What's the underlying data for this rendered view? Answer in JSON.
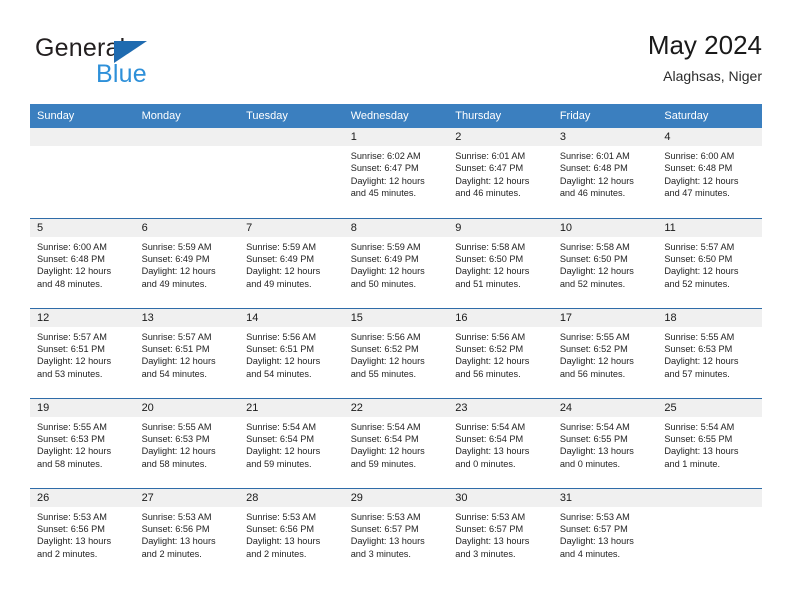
{
  "brand": {
    "name_part1": "General",
    "name_part2": "Blue",
    "triangle_color": "#1f6bb0",
    "blue_text_color": "#2e90d9"
  },
  "header": {
    "title": "May 2024",
    "subtitle": "Alaghsas, Niger"
  },
  "theme": {
    "header_row_bg": "#3b7fbf",
    "header_row_text": "#ffffff",
    "daynum_band_bg": "#f0f0f0",
    "row_separator": "#2f6ca8",
    "cell_bg": "#ffffff",
    "body_text": "#232323"
  },
  "weekday_headers": [
    "Sunday",
    "Monday",
    "Tuesday",
    "Wednesday",
    "Thursday",
    "Friday",
    "Saturday"
  ],
  "weeks": [
    [
      {
        "day": "",
        "empty": true,
        "sunrise": "",
        "sunset": "",
        "daylight_line1": "",
        "daylight_line2": ""
      },
      {
        "day": "",
        "empty": true,
        "sunrise": "",
        "sunset": "",
        "daylight_line1": "",
        "daylight_line2": ""
      },
      {
        "day": "",
        "empty": true,
        "sunrise": "",
        "sunset": "",
        "daylight_line1": "",
        "daylight_line2": ""
      },
      {
        "day": "1",
        "sunrise": "Sunrise: 6:02 AM",
        "sunset": "Sunset: 6:47 PM",
        "daylight_line1": "Daylight: 12 hours",
        "daylight_line2": "and 45 minutes."
      },
      {
        "day": "2",
        "sunrise": "Sunrise: 6:01 AM",
        "sunset": "Sunset: 6:47 PM",
        "daylight_line1": "Daylight: 12 hours",
        "daylight_line2": "and 46 minutes."
      },
      {
        "day": "3",
        "sunrise": "Sunrise: 6:01 AM",
        "sunset": "Sunset: 6:48 PM",
        "daylight_line1": "Daylight: 12 hours",
        "daylight_line2": "and 46 minutes."
      },
      {
        "day": "4",
        "sunrise": "Sunrise: 6:00 AM",
        "sunset": "Sunset: 6:48 PM",
        "daylight_line1": "Daylight: 12 hours",
        "daylight_line2": "and 47 minutes."
      }
    ],
    [
      {
        "day": "5",
        "sunrise": "Sunrise: 6:00 AM",
        "sunset": "Sunset: 6:48 PM",
        "daylight_line1": "Daylight: 12 hours",
        "daylight_line2": "and 48 minutes."
      },
      {
        "day": "6",
        "sunrise": "Sunrise: 5:59 AM",
        "sunset": "Sunset: 6:49 PM",
        "daylight_line1": "Daylight: 12 hours",
        "daylight_line2": "and 49 minutes."
      },
      {
        "day": "7",
        "sunrise": "Sunrise: 5:59 AM",
        "sunset": "Sunset: 6:49 PM",
        "daylight_line1": "Daylight: 12 hours",
        "daylight_line2": "and 49 minutes."
      },
      {
        "day": "8",
        "sunrise": "Sunrise: 5:59 AM",
        "sunset": "Sunset: 6:49 PM",
        "daylight_line1": "Daylight: 12 hours",
        "daylight_line2": "and 50 minutes."
      },
      {
        "day": "9",
        "sunrise": "Sunrise: 5:58 AM",
        "sunset": "Sunset: 6:50 PM",
        "daylight_line1": "Daylight: 12 hours",
        "daylight_line2": "and 51 minutes."
      },
      {
        "day": "10",
        "sunrise": "Sunrise: 5:58 AM",
        "sunset": "Sunset: 6:50 PM",
        "daylight_line1": "Daylight: 12 hours",
        "daylight_line2": "and 52 minutes."
      },
      {
        "day": "11",
        "sunrise": "Sunrise: 5:57 AM",
        "sunset": "Sunset: 6:50 PM",
        "daylight_line1": "Daylight: 12 hours",
        "daylight_line2": "and 52 minutes."
      }
    ],
    [
      {
        "day": "12",
        "sunrise": "Sunrise: 5:57 AM",
        "sunset": "Sunset: 6:51 PM",
        "daylight_line1": "Daylight: 12 hours",
        "daylight_line2": "and 53 minutes."
      },
      {
        "day": "13",
        "sunrise": "Sunrise: 5:57 AM",
        "sunset": "Sunset: 6:51 PM",
        "daylight_line1": "Daylight: 12 hours",
        "daylight_line2": "and 54 minutes."
      },
      {
        "day": "14",
        "sunrise": "Sunrise: 5:56 AM",
        "sunset": "Sunset: 6:51 PM",
        "daylight_line1": "Daylight: 12 hours",
        "daylight_line2": "and 54 minutes."
      },
      {
        "day": "15",
        "sunrise": "Sunrise: 5:56 AM",
        "sunset": "Sunset: 6:52 PM",
        "daylight_line1": "Daylight: 12 hours",
        "daylight_line2": "and 55 minutes."
      },
      {
        "day": "16",
        "sunrise": "Sunrise: 5:56 AM",
        "sunset": "Sunset: 6:52 PM",
        "daylight_line1": "Daylight: 12 hours",
        "daylight_line2": "and 56 minutes."
      },
      {
        "day": "17",
        "sunrise": "Sunrise: 5:55 AM",
        "sunset": "Sunset: 6:52 PM",
        "daylight_line1": "Daylight: 12 hours",
        "daylight_line2": "and 56 minutes."
      },
      {
        "day": "18",
        "sunrise": "Sunrise: 5:55 AM",
        "sunset": "Sunset: 6:53 PM",
        "daylight_line1": "Daylight: 12 hours",
        "daylight_line2": "and 57 minutes."
      }
    ],
    [
      {
        "day": "19",
        "sunrise": "Sunrise: 5:55 AM",
        "sunset": "Sunset: 6:53 PM",
        "daylight_line1": "Daylight: 12 hours",
        "daylight_line2": "and 58 minutes."
      },
      {
        "day": "20",
        "sunrise": "Sunrise: 5:55 AM",
        "sunset": "Sunset: 6:53 PM",
        "daylight_line1": "Daylight: 12 hours",
        "daylight_line2": "and 58 minutes."
      },
      {
        "day": "21",
        "sunrise": "Sunrise: 5:54 AM",
        "sunset": "Sunset: 6:54 PM",
        "daylight_line1": "Daylight: 12 hours",
        "daylight_line2": "and 59 minutes."
      },
      {
        "day": "22",
        "sunrise": "Sunrise: 5:54 AM",
        "sunset": "Sunset: 6:54 PM",
        "daylight_line1": "Daylight: 12 hours",
        "daylight_line2": "and 59 minutes."
      },
      {
        "day": "23",
        "sunrise": "Sunrise: 5:54 AM",
        "sunset": "Sunset: 6:54 PM",
        "daylight_line1": "Daylight: 13 hours",
        "daylight_line2": "and 0 minutes."
      },
      {
        "day": "24",
        "sunrise": "Sunrise: 5:54 AM",
        "sunset": "Sunset: 6:55 PM",
        "daylight_line1": "Daylight: 13 hours",
        "daylight_line2": "and 0 minutes."
      },
      {
        "day": "25",
        "sunrise": "Sunrise: 5:54 AM",
        "sunset": "Sunset: 6:55 PM",
        "daylight_line1": "Daylight: 13 hours",
        "daylight_line2": "and 1 minute."
      }
    ],
    [
      {
        "day": "26",
        "sunrise": "Sunrise: 5:53 AM",
        "sunset": "Sunset: 6:56 PM",
        "daylight_line1": "Daylight: 13 hours",
        "daylight_line2": "and 2 minutes."
      },
      {
        "day": "27",
        "sunrise": "Sunrise: 5:53 AM",
        "sunset": "Sunset: 6:56 PM",
        "daylight_line1": "Daylight: 13 hours",
        "daylight_line2": "and 2 minutes."
      },
      {
        "day": "28",
        "sunrise": "Sunrise: 5:53 AM",
        "sunset": "Sunset: 6:56 PM",
        "daylight_line1": "Daylight: 13 hours",
        "daylight_line2": "and 2 minutes."
      },
      {
        "day": "29",
        "sunrise": "Sunrise: 5:53 AM",
        "sunset": "Sunset: 6:57 PM",
        "daylight_line1": "Daylight: 13 hours",
        "daylight_line2": "and 3 minutes."
      },
      {
        "day": "30",
        "sunrise": "Sunrise: 5:53 AM",
        "sunset": "Sunset: 6:57 PM",
        "daylight_line1": "Daylight: 13 hours",
        "daylight_line2": "and 3 minutes."
      },
      {
        "day": "31",
        "sunrise": "Sunrise: 5:53 AM",
        "sunset": "Sunset: 6:57 PM",
        "daylight_line1": "Daylight: 13 hours",
        "daylight_line2": "and 4 minutes."
      },
      {
        "day": "",
        "empty": true,
        "sunrise": "",
        "sunset": "",
        "daylight_line1": "",
        "daylight_line2": ""
      }
    ]
  ]
}
